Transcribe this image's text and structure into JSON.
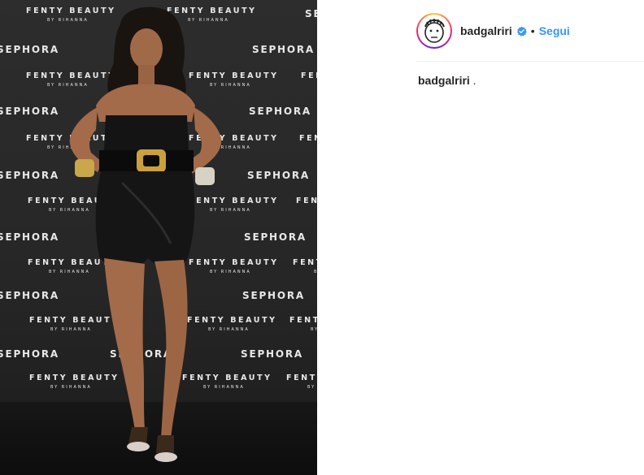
{
  "photo": {
    "alt_icon": "photo-image",
    "backdrop": {
      "brand_text": "FENTY BEAUTY",
      "brand_sub": "BY RIHANNA",
      "store_text": "SEPHORA"
    }
  },
  "post": {
    "username": "badgalriri",
    "verified_icon": "verified-badge-icon",
    "separator": "•",
    "follow_label": "Segui",
    "caption_user": "badgalriri",
    "caption_text": " ."
  },
  "colors": {
    "follow_blue": "#3897f0",
    "verified_blue": "#3897f0",
    "text": "#262626",
    "divider": "#efefef"
  }
}
